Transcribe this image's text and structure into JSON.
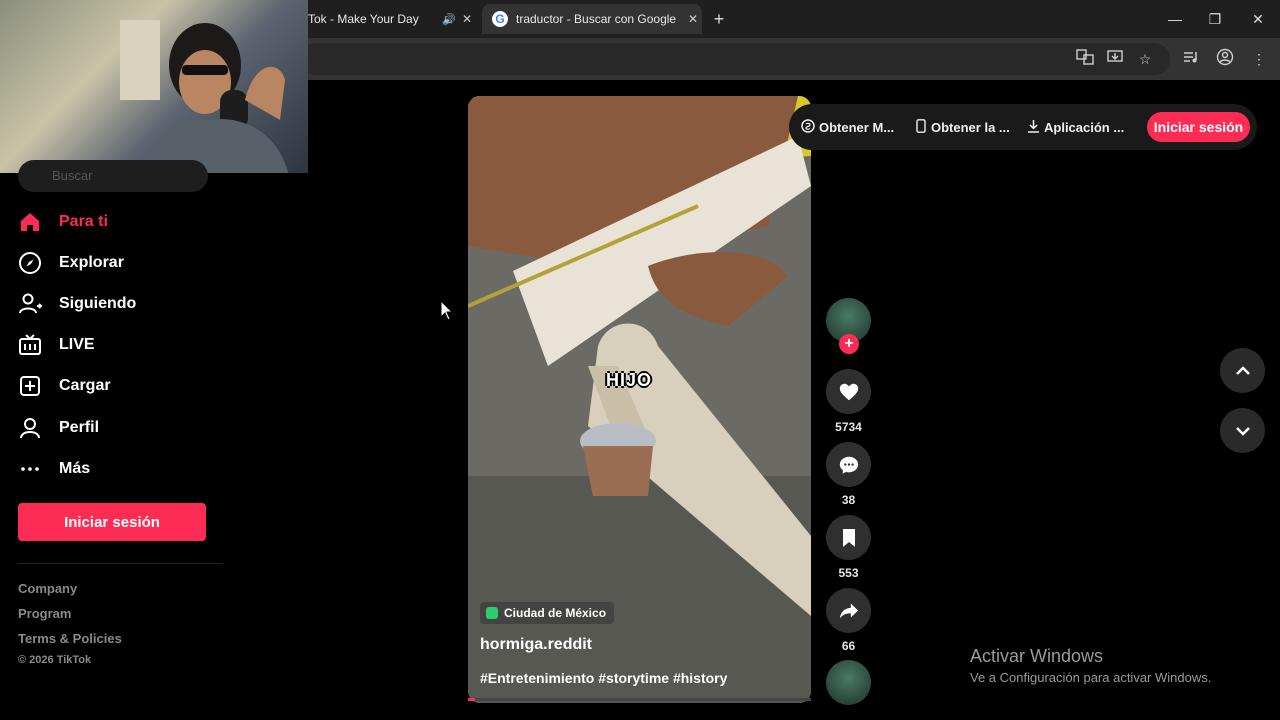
{
  "browser": {
    "tabs": [
      {
        "title": "Tok - Make Your Day",
        "active": false
      },
      {
        "title": "traductor - Buscar con Google",
        "active": true
      }
    ],
    "new_tab_icon": "plus-icon",
    "window_controls": [
      "minimize",
      "restore",
      "close"
    ]
  },
  "sidebar": {
    "search_placeholder": "Buscar",
    "items": [
      {
        "label": "Para ti",
        "icon": "home-icon",
        "active": true
      },
      {
        "label": "Explorar",
        "icon": "compass-icon",
        "active": false
      },
      {
        "label": "Siguiendo",
        "icon": "following-icon",
        "active": false
      },
      {
        "label": "LIVE",
        "icon": "live-tv-icon",
        "active": false
      },
      {
        "label": "Cargar",
        "icon": "upload-icon",
        "active": false
      },
      {
        "label": "Perfil",
        "icon": "profile-icon",
        "active": false
      },
      {
        "label": "Más",
        "icon": "more-icon",
        "active": false
      }
    ],
    "login_label": "Iniciar sesión",
    "footer_links": [
      "Company",
      "Program",
      "Terms & Policies"
    ],
    "copyright": "© 2026 TikTok"
  },
  "topbar": {
    "items": [
      {
        "label": "Obtener M...",
        "icon": "coin-icon"
      },
      {
        "label": "Obtener la ...",
        "icon": "phone-icon"
      },
      {
        "label": "Aplicación ...",
        "icon": "download-icon"
      }
    ],
    "login_label": "Iniciar sesión"
  },
  "video": {
    "caption_overlay": "HIJO",
    "location": "Ciudad de México",
    "author": "hormiga.reddit",
    "hashtags": "#Entretenimiento #storytime #history",
    "progress": 0.02
  },
  "actions": {
    "likes": "5734",
    "comments": "38",
    "saves": "553",
    "shares": "66"
  },
  "windows_watermark": {
    "title": "Activar Windows",
    "subtitle": "Ve a Configuración para activar Windows."
  },
  "colors": {
    "accent": "#fe2c55",
    "background": "#000000"
  }
}
